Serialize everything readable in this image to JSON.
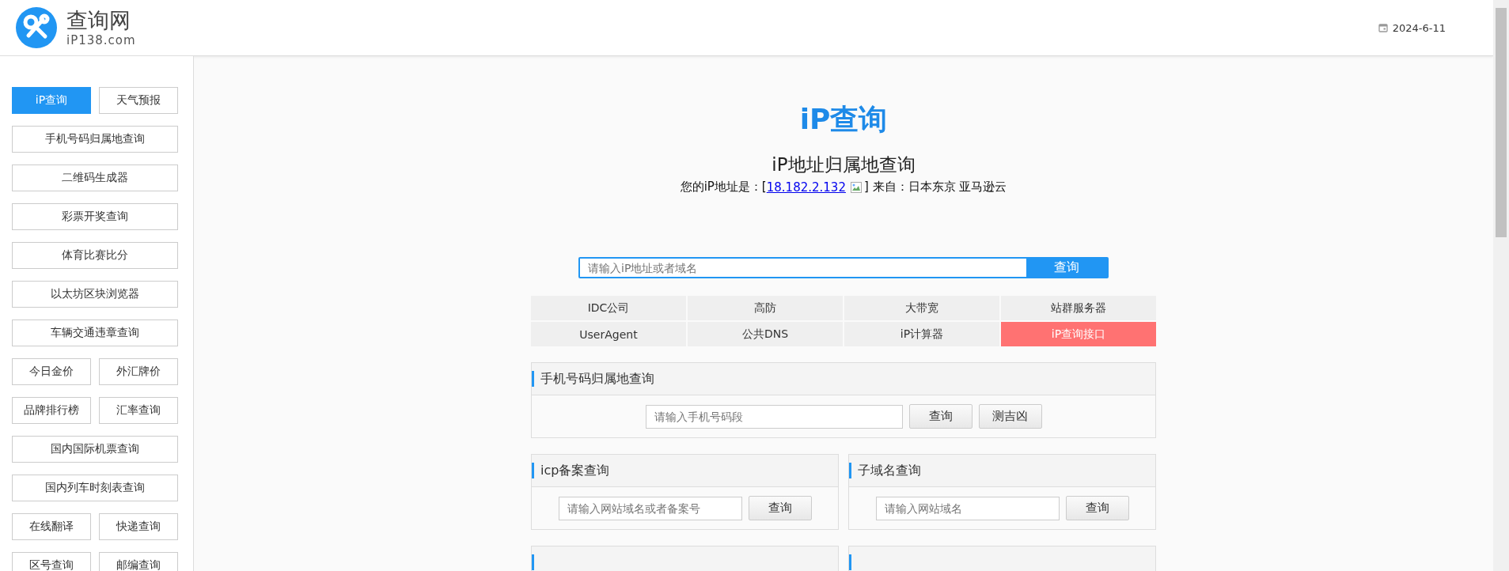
{
  "header": {
    "logo_title": "查询网",
    "logo_subtitle": "iP138.com",
    "date": "2024-6-11"
  },
  "sidebar": {
    "rows": [
      [
        {
          "label": "iP查询",
          "selected": true
        },
        {
          "label": "天气预报",
          "selected": false
        }
      ],
      [
        {
          "label": "手机号码归属地查询",
          "selected": false
        }
      ],
      [
        {
          "label": "二维码生成器",
          "selected": false
        }
      ],
      [
        {
          "label": "彩票开奖查询",
          "selected": false
        }
      ],
      [
        {
          "label": "体育比赛比分",
          "selected": false
        }
      ],
      [
        {
          "label": "以太坊区块浏览器",
          "selected": false
        }
      ],
      [
        {
          "label": "车辆交通违章查询",
          "selected": false
        }
      ],
      [
        {
          "label": "今日金价",
          "selected": false
        },
        {
          "label": "外汇牌价",
          "selected": false
        }
      ],
      [
        {
          "label": "品牌排行榜",
          "selected": false
        },
        {
          "label": "汇率查询",
          "selected": false
        }
      ],
      [
        {
          "label": "国内国际机票查询",
          "selected": false
        }
      ],
      [
        {
          "label": "国内列车时刻表查询",
          "selected": false
        }
      ],
      [
        {
          "label": "在线翻译",
          "selected": false
        },
        {
          "label": "快递查询",
          "selected": false
        }
      ],
      [
        {
          "label": "区号查询",
          "selected": false
        },
        {
          "label": "邮编查询",
          "selected": false
        }
      ]
    ]
  },
  "main": {
    "title": "iP查询",
    "subtitle": "iP地址归属地查询",
    "ip_line": {
      "prefix": "您的iP地址是：[",
      "ip": "18.182.2.132",
      "suffix": "] 来自：日本东京 亚马逊云"
    },
    "search": {
      "placeholder": "请输入iP地址或者域名",
      "button": "查询"
    },
    "links": [
      {
        "label": "IDC公司",
        "highlighted": false
      },
      {
        "label": "高防",
        "highlighted": false
      },
      {
        "label": "大带宽",
        "highlighted": false
      },
      {
        "label": "站群服务器",
        "highlighted": false
      },
      {
        "label": "UserAgent",
        "highlighted": false
      },
      {
        "label": "公共DNS",
        "highlighted": false
      },
      {
        "label": "iP计算器",
        "highlighted": false
      },
      {
        "label": "iP查询接口",
        "highlighted": true
      }
    ],
    "panels": [
      [
        {
          "title": "手机号码归属地查询",
          "placeholder": "请输入手机号码段",
          "buttons": [
            "查询",
            "测吉凶"
          ]
        }
      ],
      [
        {
          "title": "icp备案查询",
          "placeholder": "请输入网站域名或者备案号",
          "buttons": [
            "查询"
          ]
        },
        {
          "title": "子域名查询",
          "placeholder": "请输入网站域名",
          "buttons": [
            "查询"
          ]
        }
      ]
    ]
  }
}
